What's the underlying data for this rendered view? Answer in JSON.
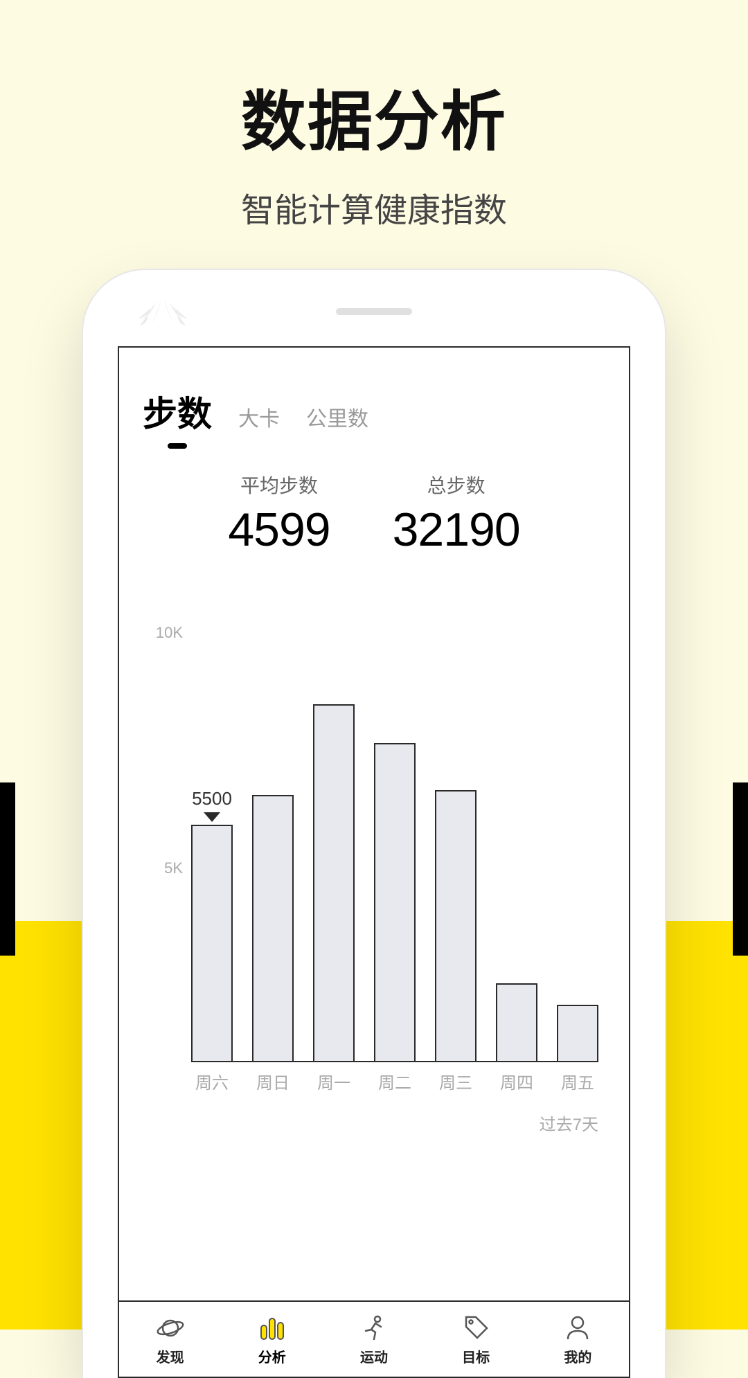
{
  "hero": {
    "title": "数据分析",
    "subtitle": "智能计算健康指数"
  },
  "tabs": [
    {
      "label": "步数",
      "active": true
    },
    {
      "label": "大卡",
      "active": false
    },
    {
      "label": "公里数",
      "active": false
    }
  ],
  "stats": {
    "avg": {
      "label": "平均步数",
      "value": "4599"
    },
    "total": {
      "label": "总步数",
      "value": "32190"
    }
  },
  "chart_data": {
    "type": "bar",
    "categories": [
      "周六",
      "周日",
      "周一",
      "周二",
      "周三",
      "周四",
      "周五"
    ],
    "values": [
      5500,
      6200,
      8300,
      7400,
      6300,
      1800,
      1300
    ],
    "ylabels": [
      "10K",
      "5K"
    ],
    "ylim": [
      0,
      10000
    ],
    "tooltip": {
      "index": 0,
      "text": "5500"
    },
    "range_label": "过去7天"
  },
  "bottom_nav": [
    {
      "id": "discover",
      "label": "发现",
      "icon": "planet-icon",
      "active": false
    },
    {
      "id": "analysis",
      "label": "分析",
      "icon": "bars-icon",
      "active": true
    },
    {
      "id": "sport",
      "label": "运动",
      "icon": "runner-icon",
      "active": false
    },
    {
      "id": "goal",
      "label": "目标",
      "icon": "tag-icon",
      "active": false
    },
    {
      "id": "mine",
      "label": "我的",
      "icon": "person-icon",
      "active": false
    }
  ],
  "colors": {
    "accent": "#ffe200",
    "bar_fill": "#e8e9ef",
    "stroke": "#2a2a2a"
  }
}
